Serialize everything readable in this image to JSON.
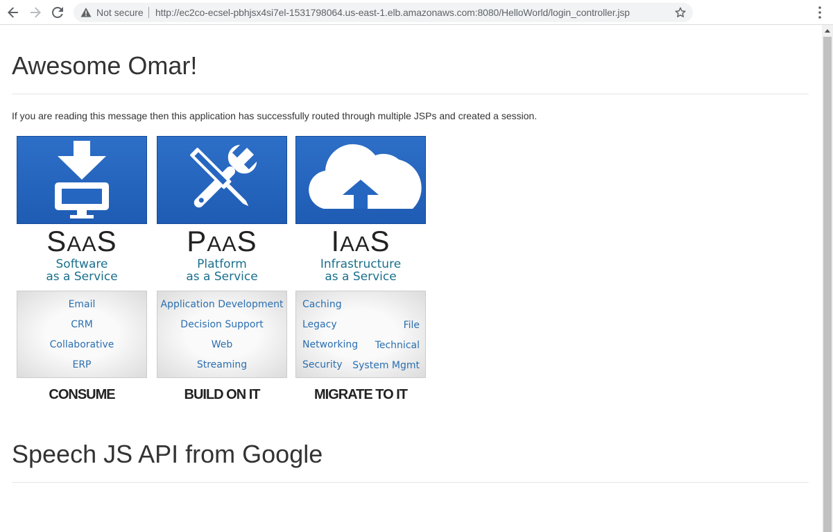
{
  "browser": {
    "security_label": "Not secure",
    "url": "http://ec2co-ecsel-pbhjsx4si7el-1531798064.us-east-1.elb.amazonaws.com:8080/HelloWorld/login_controller.jsp"
  },
  "page": {
    "heading": "Awesome Omar!",
    "message": "If you are reading this message then this application has successfully routed through multiple JSPs and created a session.",
    "section2_heading": "Speech JS API from Google"
  },
  "cards": [
    {
      "acronym_big1": "S",
      "acronym_small": "AA",
      "acronym_big2": "S",
      "subtitle_line1": "Software",
      "subtitle_line2": "as a Service",
      "items": [
        "Email",
        "CRM",
        "Collaborative",
        "ERP"
      ],
      "verb": "CONSUME",
      "icon": "download-monitor-icon"
    },
    {
      "acronym_big1": "P",
      "acronym_small": "AA",
      "acronym_big2": "S",
      "subtitle_line1": "Platform",
      "subtitle_line2": "as a Service",
      "items": [
        "Application Development",
        "Decision Support",
        "Web",
        "Streaming"
      ],
      "verb": "BUILD ON IT",
      "icon": "wrench-screwdriver-icon"
    },
    {
      "acronym_big1": "I",
      "acronym_small": "AA",
      "acronym_big2": "S",
      "subtitle_line1": "Infrastructure",
      "subtitle_line2": "as a Service",
      "items": [
        "Caching",
        "Legacy",
        "File",
        "Networking",
        "Technical",
        "Security",
        "System Mgmt"
      ],
      "verb": "MIGRATE TO IT",
      "icon": "cloud-upload-icon"
    }
  ],
  "colors": {
    "tile_blue": "#2d6fc8",
    "subtitle_teal": "#1a6f8c",
    "item_blue": "#2a6fb0"
  }
}
